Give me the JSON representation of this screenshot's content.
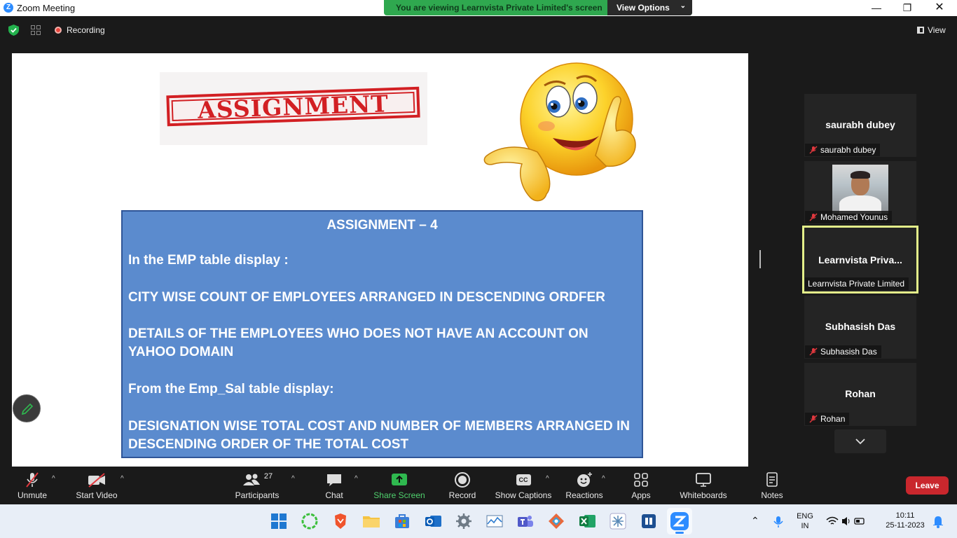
{
  "window": {
    "title": "Zoom Meeting",
    "banner_text": "You are viewing Learnvista Private Limited's screen",
    "view_options_label": "View Options"
  },
  "topbar": {
    "recording_label": "Recording",
    "view_label": "View"
  },
  "shared_screen": {
    "stamp_text": "ASSIGNMENT",
    "title": "ASSIGNMENT – 4",
    "lines": [
      "In the EMP table display  :",
      "CITY WISE COUNT OF EMPLOYEES ARRANGED IN DESCENDING ORDFER",
      "DETAILS OF THE EMPLOYEES WHO DOES NOT HAVE AN ACCOUNT ON YAHOO DOMAIN",
      "From the Emp_Sal table display:",
      "DESIGNATION WISE TOTAL COST AND NUMBER OF MEMBERS ARRANGED IN DESCENDING ORDER OF THE TOTAL COST"
    ]
  },
  "participants": [
    {
      "display_name": "saurabh dubey",
      "label": "saurabh dubey",
      "muted": true
    },
    {
      "display_name": "",
      "label": "Mohamed Younus",
      "muted": true
    },
    {
      "display_name": "Learnvista  Priva...",
      "label": "Learnvista Private Limited",
      "muted": false
    },
    {
      "display_name": "Subhasish Das",
      "label": "Subhasish Das",
      "muted": true
    },
    {
      "display_name": "Rohan",
      "label": "Rohan",
      "muted": true
    }
  ],
  "toolbar": {
    "unmute": "Unmute",
    "start_video": "Start Video",
    "participants": "Participants",
    "participants_count": "27",
    "chat": "Chat",
    "share_screen": "Share Screen",
    "record": "Record",
    "show_captions": "Show Captions",
    "captions_badge": "CC",
    "reactions": "Reactions",
    "apps": "Apps",
    "whiteboards": "Whiteboards",
    "notes": "Notes",
    "leave": "Leave"
  },
  "taskbar": {
    "lang_top": "ENG",
    "lang_bottom": "IN",
    "time": "10:11",
    "date": "25-11-2023"
  },
  "colors": {
    "banner_green": "#2fa84f",
    "assignment_box": "#5b8bce",
    "leave_red": "#c9272d",
    "active_speaker_border": "#e4f08a"
  }
}
